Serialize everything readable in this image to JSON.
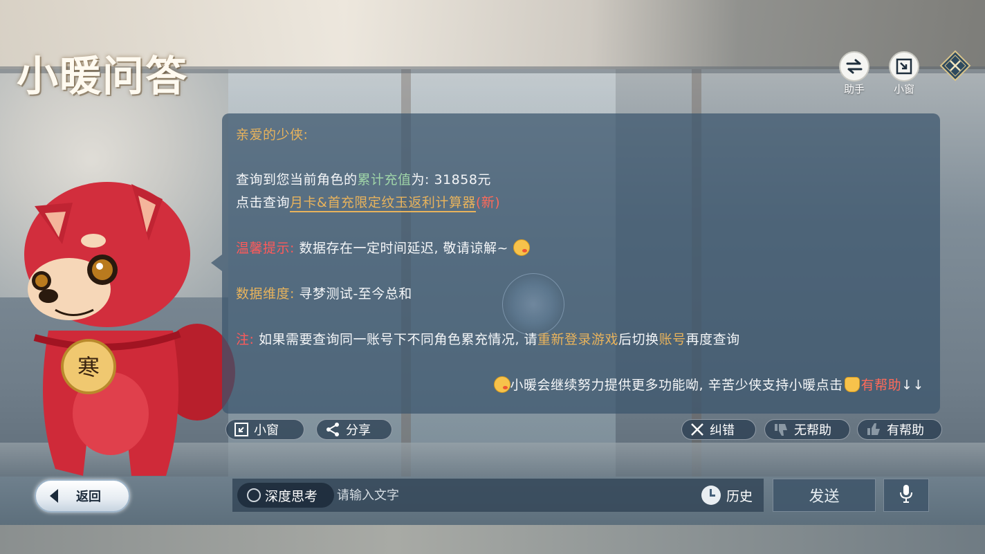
{
  "app": {
    "title": "小暖问答"
  },
  "topbar": {
    "assistant_label": "助手",
    "mini_window_label": "小窗"
  },
  "mascot": {
    "medal_text": "寒"
  },
  "message": {
    "greeting": "亲爱的少侠:",
    "query_prefix": "查询到您当前角色的",
    "query_highlight": "累计充值",
    "query_suffix": "为: 31858元",
    "click_prefix": "点击查询",
    "link_text": "月卡&首充限定纹玉返利计算器",
    "link_new": "(新)",
    "tip_label": "温馨提示:",
    "tip_text": " 数据存在一定时间延迟, 敬请谅解~",
    "dimension_label": "数据维度:",
    "dimension_text": " 寻梦测试-至今总和",
    "note_label": "注:",
    "note_text_1": " 如果需要查询同一账号下不同角色累充情况, 请",
    "note_highlight_1": "重新登录游戏",
    "note_text_2": "后切换",
    "note_highlight_2": "账号",
    "note_text_3": "再度查询",
    "footer_text": "小暖会继续努力提供更多功能呦, 辛苦少侠支持小暖点击",
    "footer_helpful": "有帮助",
    "footer_arrows": "↓↓"
  },
  "actions": {
    "mini_window": "小窗",
    "share": "分享",
    "correct": "纠错",
    "not_helpful": "无帮助",
    "helpful": "有帮助"
  },
  "input": {
    "back_label": "返回",
    "deep_think_label": "深度思考",
    "placeholder": "请输入文字",
    "history_label": "历史",
    "send_label": "发送"
  },
  "colors": {
    "gold": "#e8b35c",
    "green": "#9fd5a8",
    "red": "#ff5a5a",
    "panel": "#3a546c"
  },
  "icons": {
    "assistant": "swap-arrows-icon",
    "mini_window": "shrink-window-icon",
    "close": "close-diamond-icon",
    "share": "share-icon",
    "correct": "x-mark-icon",
    "not_helpful": "thumbs-down-icon",
    "helpful": "thumbs-up-icon",
    "history": "clock-icon",
    "mic": "microphone-icon"
  }
}
